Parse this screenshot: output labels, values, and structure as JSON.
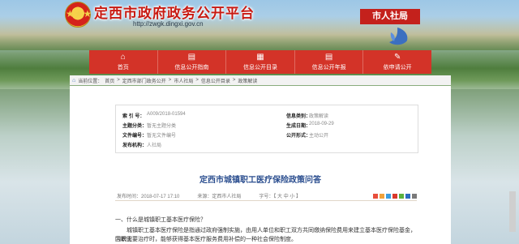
{
  "header": {
    "site_title": "定西市政府政务公开平台",
    "site_url": "http://zwgk.dingxi.gov.cn",
    "department": "市人社局",
    "emblem_glyph": "★★★"
  },
  "nav": {
    "items": [
      {
        "label": "首页",
        "icon": "home-icon",
        "glyph": "⌂"
      },
      {
        "label": "信息公开指南",
        "icon": "guide-icon",
        "glyph": "▤"
      },
      {
        "label": "信息公开目录",
        "icon": "catalog-icon",
        "glyph": "▦"
      },
      {
        "label": "信息公开年报",
        "icon": "report-icon",
        "glyph": "▤"
      },
      {
        "label": "依申请公开",
        "icon": "apply-icon",
        "glyph": "✎"
      }
    ]
  },
  "breadcrumb": {
    "prefix": "当前位置：",
    "items": [
      "首页",
      "定西市部门政务公开",
      "市人社局",
      "信息公开目录",
      "政策解读"
    ],
    "separator": ">"
  },
  "meta": {
    "index_label": "索 引 号：",
    "index_value": "A009/2018-01594",
    "theme_label": "主题分类：",
    "theme_value": "暂无主题分类",
    "fileno_label": "文件编号：",
    "fileno_value": "暂无文件编号",
    "publisher_label": "发布机构：",
    "publisher_value": "人社局",
    "category_label": "信息类别：",
    "category_value": "政策解读",
    "date_label": "生成日期：",
    "date_value": "2018-09-29",
    "mode_label": "公开形式：",
    "mode_value": "主动公开"
  },
  "article": {
    "title": "定西市城镇职工医疗保险政策问答",
    "published": "发布时间：2018-07-17 17:10",
    "source": "来源：定西市人社局",
    "font_size": "字号：【 大 中 小 】",
    "question": "一、什么是城镇职工基本医疗保险？",
    "answer_line1": "城镇职工基本医疗保险是指通过政府强制实施，由用人单位和职工双方共同缴纳保险费用来建立基本医疗保险基金，当职工",
    "answer_line2": "因病需要治疗时，能够获得基本医疗服务费用补偿的一种社会保险制度。"
  },
  "colors": {
    "brand_red": "#c81a12",
    "nav_red": "#d33328",
    "title_blue": "#2b4e8f"
  }
}
